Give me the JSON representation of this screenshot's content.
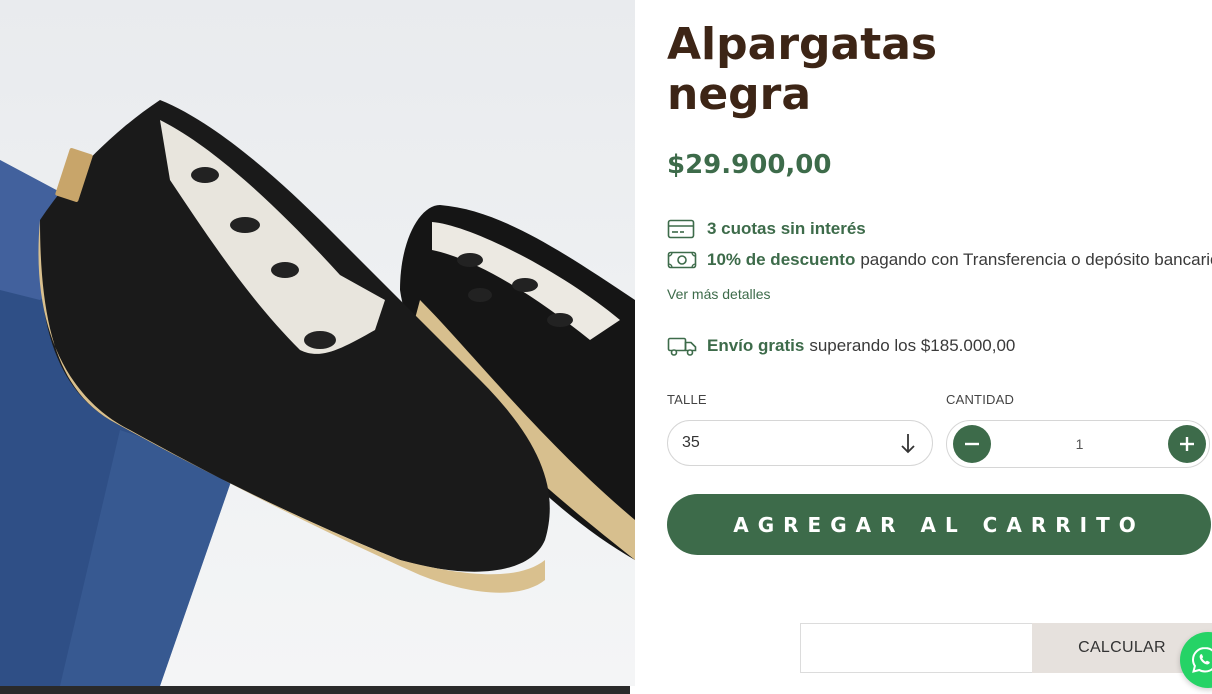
{
  "product": {
    "image_alt": "Alpargatas negra",
    "title": "Alpargatas negra",
    "price": "$29.900,00"
  },
  "payment": {
    "installments_highlight": "3 cuotas sin interés",
    "discount_highlight": "10% de descuento",
    "discount_rest": "pagando con Transferencia o depósito bancario",
    "more_details": "Ver más detalles"
  },
  "shipping": {
    "free_highlight": "Envío gratis",
    "free_rest": "superando los $185.000,00"
  },
  "options": {
    "size_label": "TALLE",
    "size_value": "35",
    "quantity_label": "CANTIDAD",
    "quantity_value": "1"
  },
  "cart": {
    "add_label": "AGREGAR AL CARRITO"
  },
  "shipping_calc": {
    "button_label": "CALCULAR",
    "input_value": ""
  },
  "colors": {
    "brand_green": "#3d6b4a",
    "title_brown": "#3d2516",
    "whatsapp_green": "#25d366"
  },
  "icons": [
    "credit-card-icon",
    "banknote-icon",
    "truck-icon",
    "arrow-down-icon",
    "minus-icon",
    "plus-icon",
    "whatsapp-icon"
  ]
}
